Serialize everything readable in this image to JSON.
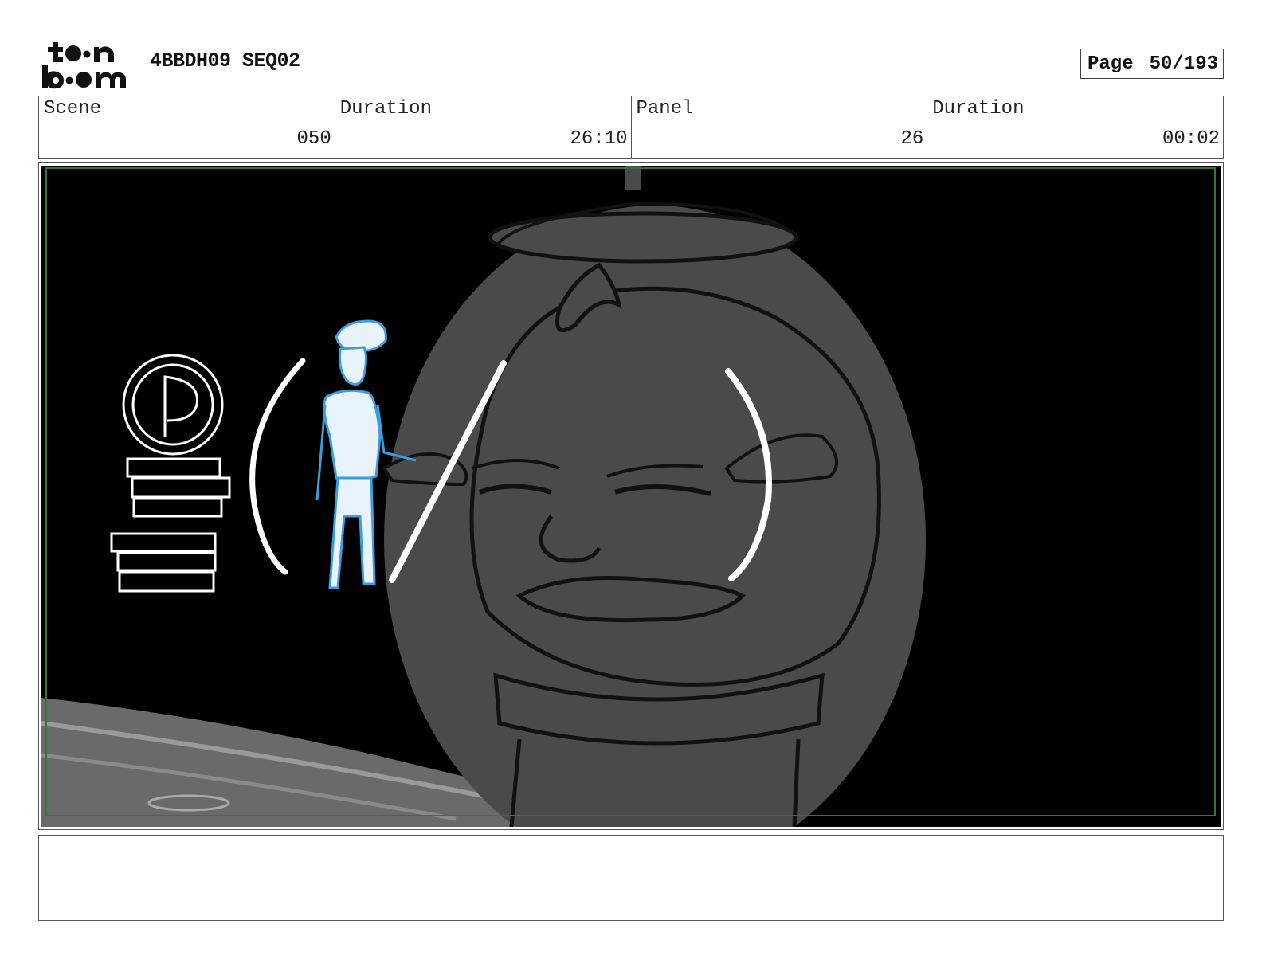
{
  "header": {
    "logo_text": "toon boom",
    "project_title": "4BBDH09 SEQ02",
    "page_label": "Page",
    "page_value": "50/193"
  },
  "info": {
    "scene_label": "Scene",
    "scene_value": "050",
    "scene_duration_label": "Duration",
    "scene_duration_value": "26:10",
    "panel_label": "Panel",
    "panel_value": "26",
    "panel_duration_label": "Duration",
    "panel_duration_value": "00:02"
  },
  "panel": {
    "image": "storyboard-panel-sketch",
    "colors": {
      "background": "#000000",
      "head": "#4a4a4a",
      "line": "#111111",
      "white_line": "#ffffff",
      "character_line": "#3a9ee0",
      "safe_frame": "#2f7a2f"
    }
  },
  "notes": {
    "text": ""
  }
}
